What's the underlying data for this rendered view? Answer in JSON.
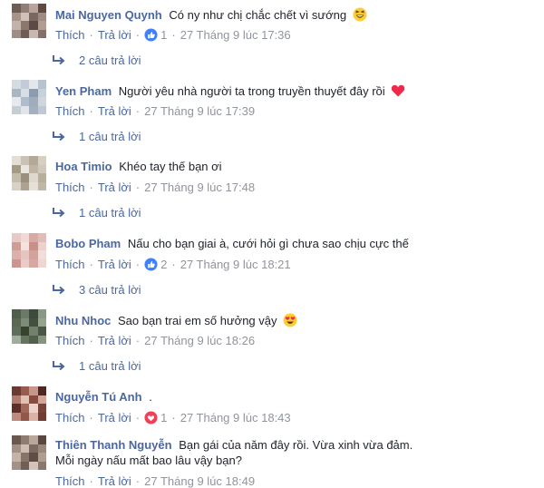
{
  "sep": "·",
  "comments": [
    {
      "name": "Mai Nguyen Quynh",
      "text": "Có ny như chị chắc chết vì sướng",
      "emoji": "grinning-squint-emoji",
      "like": "Thích",
      "reply": "Trả lời",
      "reaction": "like-reaction-icon",
      "reaction_count": "1",
      "time": "27 Tháng 9 lúc 17:36",
      "replies": "2 câu trả lời",
      "avatar_colors": [
        "#6d5b55",
        "#8f7f78",
        "#b7a49c",
        "#5e4a44",
        "#a89387",
        "#d1c2b9",
        "#7a6760",
        "#9e8c84",
        "#c3b3ab",
        "#8c776e",
        "#5b4a45",
        "#b29d92",
        "#a08d83",
        "#6e5c56",
        "#c9b8af",
        "#847067"
      ]
    },
    {
      "name": "Yen Pham",
      "text": "Người yêu nhà người ta trong truyền thuyết đây rồi",
      "emoji": "heart-emoji",
      "like": "Thích",
      "reply": "Trả lời",
      "reaction": "",
      "reaction_count": "",
      "time": "27 Tháng 9 lúc 17:39",
      "replies": "1 câu trả lời",
      "avatar_colors": [
        "#d5dbe3",
        "#c2ccd8",
        "#e3e7ec",
        "#b9c3cf",
        "#aab6c4",
        "#d9dee5",
        "#8d9cad",
        "#c8d0da",
        "#e6e9ed",
        "#b0bccb",
        "#9fadbd",
        "#d0d6de",
        "#c5cdd7",
        "#e1e5ea",
        "#a3b0c0",
        "#bfc8d3"
      ]
    },
    {
      "name": "Hoa Timio",
      "text": "Khéo tay thế bạn ơi",
      "emoji": "",
      "like": "Thích",
      "reply": "Trả lời",
      "reaction": "",
      "reaction_count": "",
      "time": "27 Tháng 9 lúc 17:48",
      "replies": "1 câu trả lời",
      "avatar_colors": [
        "#e2ddd5",
        "#c9c1b4",
        "#b3a996",
        "#d6cfc3",
        "#a59a86",
        "#eae6df",
        "#bfb5a4",
        "#d0c8ba",
        "#c6bcab",
        "#9b907d",
        "#ded8ce",
        "#b8ae9c",
        "#d8d1c5",
        "#aea391",
        "#e5e0d8",
        "#c1b7a6"
      ]
    },
    {
      "name": "Bobo Pham",
      "text": "Nấu cho bạn giai à, cưới hỏi gì chưa sao chịu cực thế",
      "emoji": "",
      "like": "Thích",
      "reply": "Trả lời",
      "reaction": "like-reaction-icon",
      "reaction_count": "2",
      "time": "27 Tháng 9 lúc 18:21",
      "replies": "3 câu trả lời",
      "avatar_colors": [
        "#e8c9c6",
        "#f0dad7",
        "#d9a9a4",
        "#e2bcb8",
        "#cf9c96",
        "#f3e3e0",
        "#c98f89",
        "#ebd0cc",
        "#dcb0ab",
        "#e6c4c0",
        "#d4a29c",
        "#f1ddda",
        "#cd958f",
        "#e9cbc7",
        "#d7a7a2",
        "#efd6d2"
      ]
    },
    {
      "name": "Nhu Nhoc",
      "text": "Sao bạn trai em số hưởng vậy",
      "emoji": "heart-eyes-emoji",
      "like": "Thích",
      "reply": "Trả lời",
      "reaction": "",
      "reaction_count": "",
      "time": "27 Tháng 9 lúc 18:26",
      "replies": "1 câu trả lời",
      "avatar_colors": [
        "#4f5d4b",
        "#6b7a66",
        "#3e4a3b",
        "#8a9885",
        "#59684f",
        "#7d8c78",
        "#44503f",
        "#96a391",
        "#5f6e5a",
        "#38432f",
        "#72806c",
        "#4a5746",
        "#a1ad9c",
        "#66745f",
        "#525f4c",
        "#85937f"
      ]
    },
    {
      "name": "Nguyễn Tú Anh",
      "text": ".",
      "emoji": "",
      "like": "Thích",
      "reply": "Trả lời",
      "reaction": "love-reaction-icon",
      "reaction_count": "1",
      "time": "27 Tháng 9 lúc 18:43",
      "replies": "",
      "avatar_colors": [
        "#6b3a33",
        "#9a5a4d",
        "#c9968a",
        "#4d2722",
        "#b07a6d",
        "#e0bfb5",
        "#874c41",
        "#d1a698",
        "#5c302a",
        "#a3685a",
        "#ecd3ca",
        "#7a433a",
        "#c08a7d",
        "#92574b",
        "#dbb2a6",
        "#6f3b34"
      ]
    },
    {
      "name": "Thiên Thanh Nguyễn",
      "text": "Bạn gái của năm đây rồi. Vừa xinh vừa đảm.",
      "text2": "Mỗi ngày nấu mất bao lâu vậy bạn?",
      "emoji": "",
      "like": "Thích",
      "reply": "Trả lời",
      "reaction": "",
      "reaction_count": "",
      "time": "27 Tháng 9 lúc 18:49",
      "replies": "",
      "avatar_colors": [
        "#6a5850",
        "#8e7b71",
        "#b9a79c",
        "#574740",
        "#a39085",
        "#cdbdb3",
        "#7c6a61",
        "#9a877c",
        "#c4b3a8",
        "#887469",
        "#5e4d46",
        "#b09d91",
        "#a49185",
        "#705e56",
        "#d3c4bb",
        "#8b786d"
      ]
    }
  ]
}
